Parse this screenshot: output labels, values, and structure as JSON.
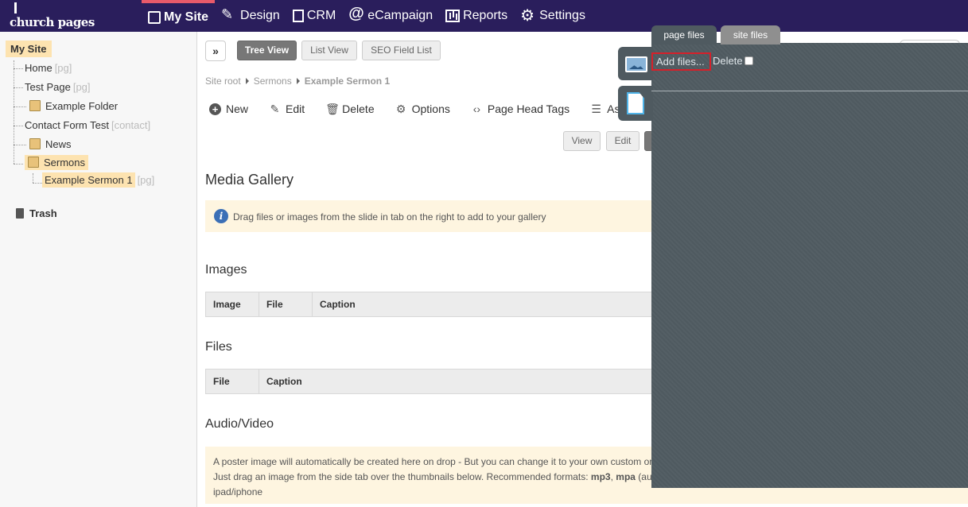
{
  "brand": {
    "name": "church pages"
  },
  "nav": [
    {
      "label": "My Site",
      "icon": "site-icon"
    },
    {
      "label": "Design",
      "icon": "design-icon"
    },
    {
      "label": "CRM",
      "icon": "crm-icon"
    },
    {
      "label": "eCampaign",
      "icon": "at-icon"
    },
    {
      "label": "Reports",
      "icon": "reports-icon"
    },
    {
      "label": "Settings",
      "icon": "gear-icon"
    }
  ],
  "sidebar": {
    "root": "My Site",
    "items": [
      {
        "label": "Home",
        "tag": "[pg]"
      },
      {
        "label": "Test Page",
        "tag": "[pg]"
      },
      {
        "label": "Example Folder",
        "tag": ""
      },
      {
        "label": "Contact Form Test",
        "tag": "[contact]"
      },
      {
        "label": "News",
        "tag": ""
      },
      {
        "label": "Sermons",
        "tag": ""
      },
      {
        "label": "Example Sermon 1",
        "tag": "[pg]"
      }
    ],
    "trash": "Trash"
  },
  "views": {
    "tree": "Tree View",
    "list": "List View",
    "seo": "SEO Field List"
  },
  "breadcrumb": {
    "root": "Site root",
    "parent": "Sermons",
    "current": "Example Sermon 1"
  },
  "toolbar": {
    "new": "New",
    "edit": "Edit",
    "delete": "Delete",
    "options": "Options",
    "head_tags": "Page Head Tags",
    "as": "As"
  },
  "modes": {
    "view": "View",
    "edit": "Edit"
  },
  "media": {
    "title": "Media Gallery",
    "hint": "Drag files or images from the slide in tab on the right to add to your gallery",
    "images_title": "Images",
    "images_cols": [
      "Image",
      "File",
      "Caption"
    ],
    "files_title": "Files",
    "files_cols": [
      "File",
      "Caption"
    ],
    "av_title": "Audio/Video",
    "av_line1": "A poster image will automatically be created here on drop - But you can change it to your own custom or",
    "av_line2_a": "Just drag an image from the side tab over the thumbnails below. Recommended formats: ",
    "av_fmt1": "mp3",
    "av_fmt2": "mpa",
    "av_line2_b": " (au",
    "av_line3": "ipad/iphone"
  },
  "panel": {
    "tab_page": "page files",
    "tab_site": "site files",
    "add_files": "Add files...",
    "delete": "Delete"
  }
}
